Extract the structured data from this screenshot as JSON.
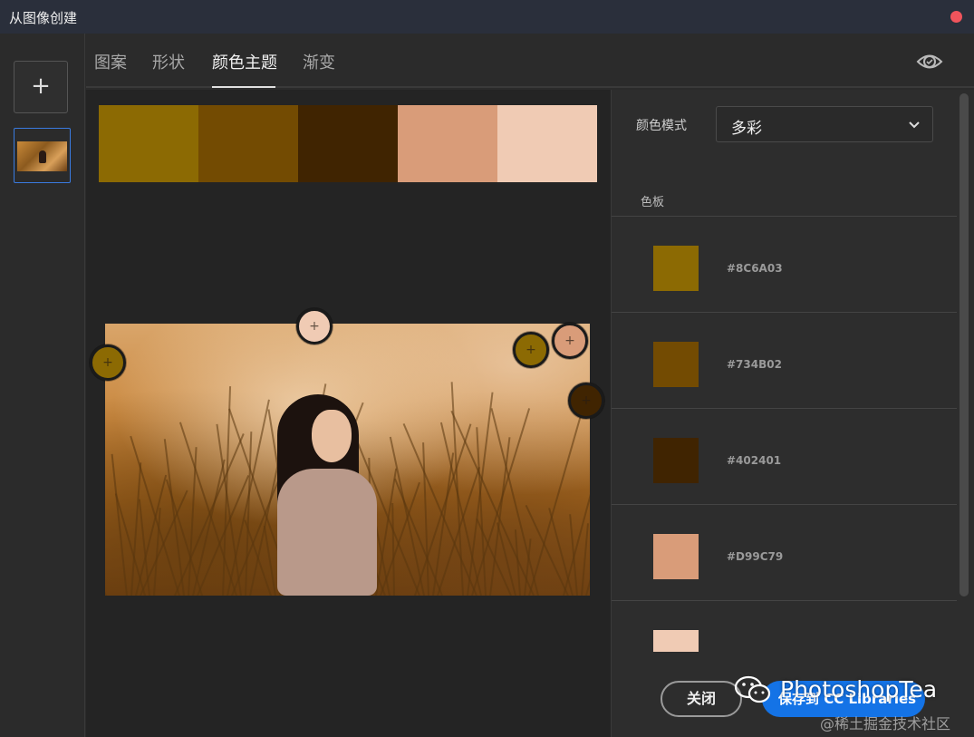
{
  "window": {
    "title": "从图像创建"
  },
  "leftbar": {
    "add_label": "+"
  },
  "tabs": [
    {
      "label": "图案",
      "active": false
    },
    {
      "label": "形状",
      "active": false
    },
    {
      "label": "颜色主题",
      "active": true
    },
    {
      "label": "渐变",
      "active": false
    }
  ],
  "swatches": [
    "#8C6A03",
    "#734B02",
    "#402401",
    "#D99C79",
    "#F0CBB4"
  ],
  "pickers": [
    {
      "color": "#F0CBB4",
      "glyph": "+"
    },
    {
      "color": "#8C6A03",
      "glyph": "+"
    },
    {
      "color": "#8C6A03",
      "glyph": "+"
    },
    {
      "color": "#D99C79",
      "glyph": "+"
    },
    {
      "color": "#402401",
      "glyph": "+"
    }
  ],
  "panel": {
    "mode_label": "颜色模式",
    "mode_value": "多彩",
    "palette_label": "色板",
    "palette": [
      {
        "color": "#8C6A03",
        "hex": "#8C6A03"
      },
      {
        "color": "#734B02",
        "hex": "#734B02"
      },
      {
        "color": "#402401",
        "hex": "#402401"
      },
      {
        "color": "#D99C79",
        "hex": "#D99C79"
      },
      {
        "color": "#F0CBB4",
        "hex": ""
      }
    ],
    "close_label": "关闭",
    "save_label": "保存到 CC Libraries"
  },
  "watermark": {
    "brand": "PhotoshopTea",
    "site": "@稀土掘金技术社区"
  },
  "colors": {
    "accent": "#1473e6",
    "close_dot": "#f0545c"
  }
}
